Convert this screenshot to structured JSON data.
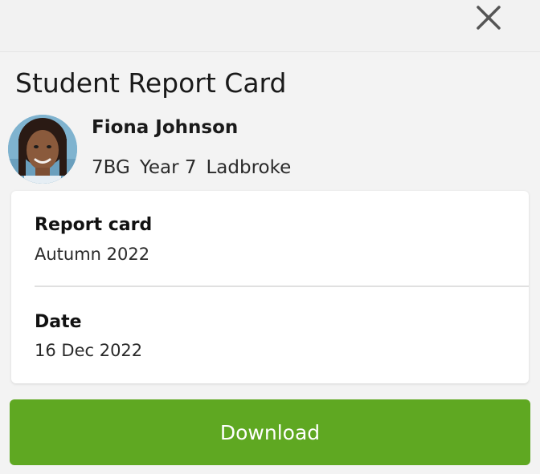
{
  "header": {
    "close_icon": "close-icon",
    "title": "Student Report Card"
  },
  "student": {
    "name": "Fiona Johnson",
    "form": "7BG",
    "year": "Year 7",
    "house": "Ladbroke"
  },
  "report": {
    "report_card_label": "Report card",
    "report_card_value": "Autumn 2022",
    "date_label": "Date",
    "date_value": "16 Dec 2022"
  },
  "actions": {
    "download_label": "Download"
  },
  "colors": {
    "primary_button": "#5fa822",
    "background": "#f3f3f3",
    "card": "#ffffff"
  }
}
